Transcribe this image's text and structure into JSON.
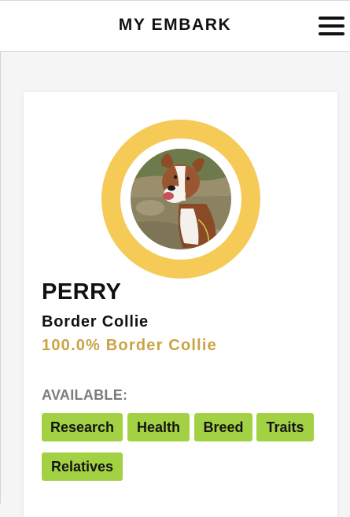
{
  "header": {
    "title": "MY EMBARK",
    "menu_icon": "hamburger-menu-icon"
  },
  "profile": {
    "photo_icon": "dog-photo",
    "name": "PERRY",
    "breed": "Border Collie",
    "breed_breakdown": "100.0% Border Collie",
    "ring_color": "#f6ca57",
    "breakdown_color": "#c9a443"
  },
  "available": {
    "label": "AVAILABLE:",
    "tags": [
      "Research",
      "Health",
      "Breed",
      "Traits",
      "Relatives"
    ],
    "tag_color": "#a3d144"
  }
}
